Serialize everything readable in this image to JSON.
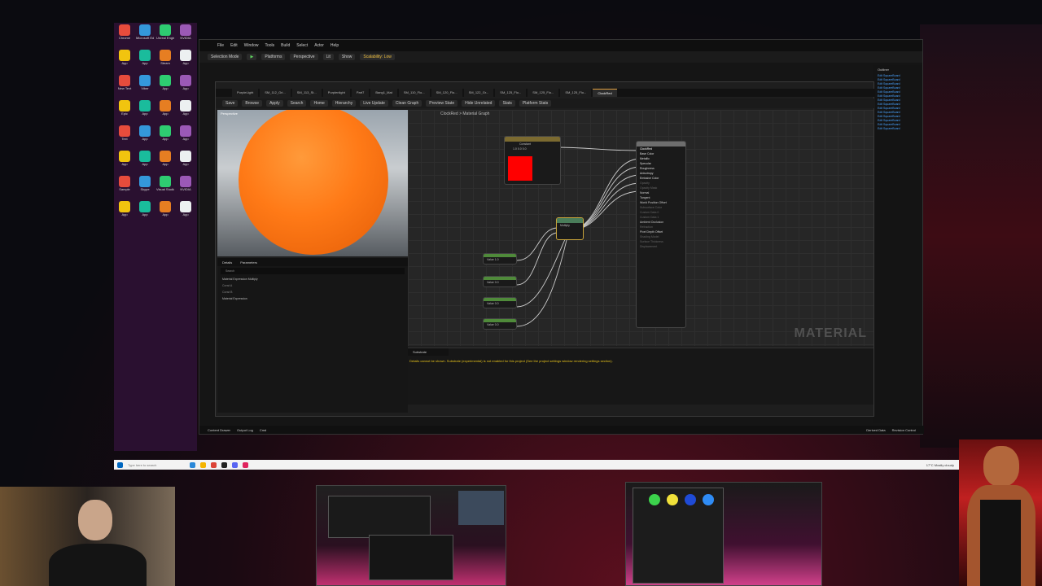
{
  "desktop": {
    "icons": [
      "Chrome",
      "Microsoft Edge",
      "Unreal Engine",
      "NVIDIA",
      "App",
      "App",
      "Steam",
      "App",
      "New Text",
      "Viber",
      "App",
      "App",
      "Epic",
      "App",
      "App",
      "App",
      "Text",
      "App",
      "App",
      "App",
      "App",
      "App",
      "App",
      "App",
      "Sample",
      "Skype",
      "Visual Studio",
      "NVIDIA",
      "App",
      "App",
      "App",
      "App"
    ]
  },
  "ue": {
    "menu": [
      "File",
      "Edit",
      "Window",
      "Tools",
      "Build",
      "Select",
      "Actor",
      "Help"
    ],
    "toolbar": {
      "mode": "Selection Mode",
      "platforms": "Platforms",
      "perspective": "Perspective",
      "lit": "Lit",
      "show": "Show",
      "scalability": "Scalability: Low"
    },
    "statusbar": [
      "Content Drawer",
      "Output Log",
      "Cmd",
      "Derived Data",
      "Revision Control"
    ],
    "outliner_title": "Outliner",
    "outliner_items": [
      "Edit SquareBoard",
      "Edit SquareBoard",
      "Edit SquareBoard",
      "Edit SquareBoard",
      "Edit SquareBoard",
      "Edit SquareBoard",
      "Edit SquareBoard",
      "Edit SquareBoard",
      "Edit SquareBoard",
      "Edit SquareBoard",
      "Edit SquareBoard",
      "Edit SquareBoard",
      "Edit SquareBoard",
      "Edit SquareBoard"
    ]
  },
  "material_editor": {
    "tabs": [
      "PurpleLight",
      "SM_112_Gri...",
      "SM_113_St...",
      "Purplenlight",
      "Part7",
      "Bang1_Mat",
      "SM_110_Flo...",
      "SM_120_Flo...",
      "SM_122_Gr...",
      "SM_125_Flo...",
      "SM_125_Flo...",
      "SM_125_Flo...",
      "ClockRed"
    ],
    "toolbar": [
      "Save",
      "Browse",
      "Apply",
      "Search",
      "Home",
      "Hierarchy",
      "Live Update",
      "Clean Graph",
      "Preview State",
      "Hide Unrelated",
      "Stats",
      "Platform Stats"
    ],
    "breadcrumb": "ClockRed > Material Graph",
    "watermark": "MATERIAL",
    "details_tabs": [
      "Details",
      "Parameters"
    ],
    "details_search": "Search",
    "details_rows": [
      "Material Expression Multiply",
      "Const A",
      "Const B",
      "Material Expression"
    ],
    "nodes": {
      "constant": {
        "title": "Constant",
        "values": [
          "1.0",
          "0.0",
          "0.0"
        ]
      },
      "multiply": {
        "title": "Multiply"
      },
      "values": [
        "1.0",
        "0.0",
        "0.0",
        "0.0"
      ],
      "value_label": "Value",
      "result": {
        "title": "ClockRed",
        "pins": [
          "Base Color",
          "Metallic",
          "Specular",
          "Roughness",
          "Anisotropy",
          "Emissive Color",
          "Opacity",
          "Opacity Mask",
          "Normal",
          "Tangent",
          "World Position Offset",
          "Subsurface Color",
          "Custom Data 0",
          "Custom Data 1",
          "Ambient Occlusion",
          "Refraction",
          "Pixel Depth Offset",
          "Shading Model",
          "Surface Thickness",
          "Displacement"
        ]
      }
    },
    "substrate_tab": "Substrate",
    "substrate_message": "Details cannot be shown. Substrate (experimental) is not enabled for this project (See the project settings window rendering settings section)."
  },
  "taskbar": {
    "search": "Type here to search",
    "tray": "17°C Mostly cloudy"
  },
  "colors": {
    "sphere": "#ff7a17",
    "constant_swatch": "#ff0000",
    "warning_text": "#e6c21b",
    "link": "#4aa3ff"
  }
}
